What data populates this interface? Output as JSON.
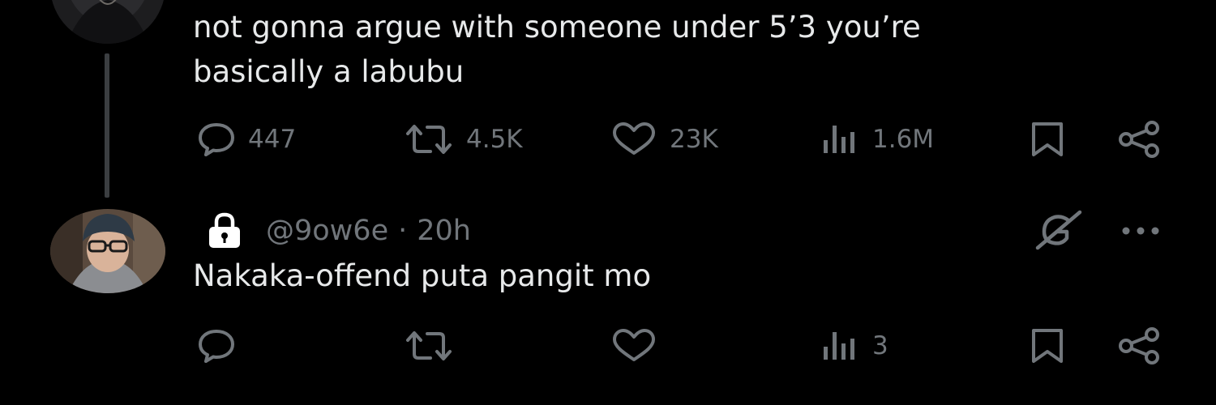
{
  "tweets": [
    {
      "text": "not gonna argue with someone under 5’3 you’re\nbasically a labubu",
      "replies": "447",
      "reposts": "4.5K",
      "likes": "23K",
      "views": "1.6M"
    },
    {
      "handle": "@9ow6e",
      "separator": "·",
      "time": "20h",
      "text": "Nakaka-offend puta pangit mo",
      "replies": "",
      "reposts": "",
      "likes": "",
      "views": "3"
    }
  ],
  "icons": {
    "reply": "reply-icon",
    "repost": "repost-icon",
    "like": "like-icon",
    "views": "views-icon",
    "bookmark": "bookmark-icon",
    "share": "share-icon",
    "lock": "lock-icon",
    "grok": "grok-icon",
    "more": "more-icon"
  },
  "colors": {
    "background": "#000000",
    "text": "#e7e9ea",
    "muted": "#71767b",
    "thread_line": "#3b3e41"
  }
}
